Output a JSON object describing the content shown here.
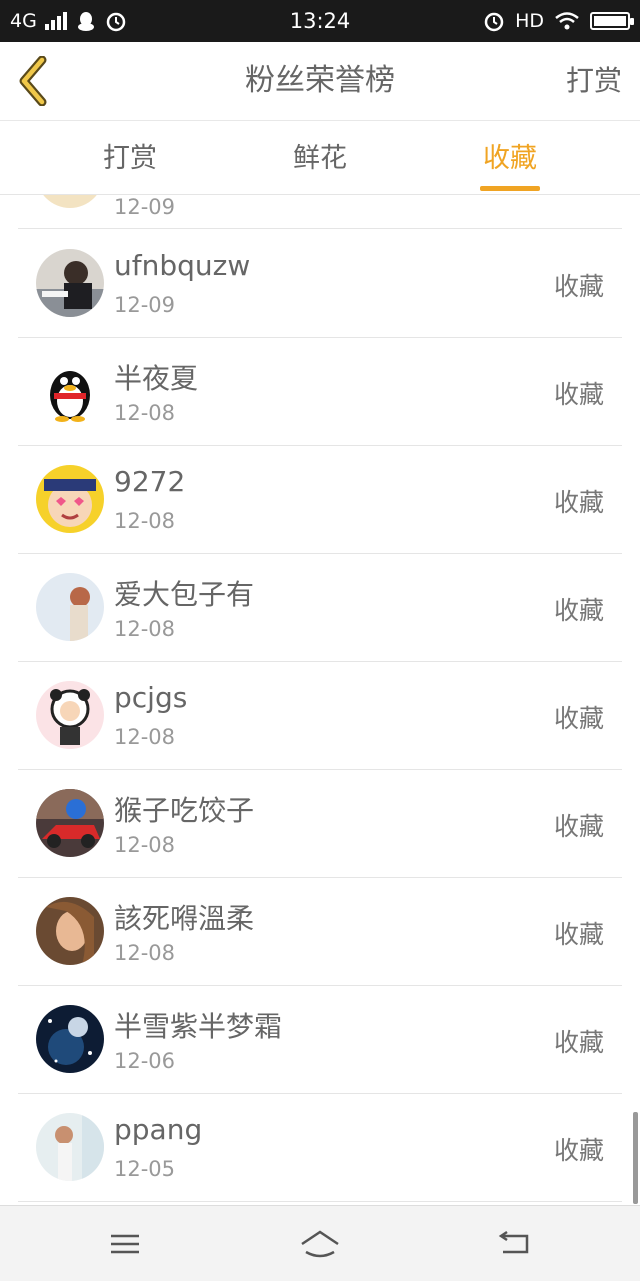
{
  "status_bar": {
    "network": "4G",
    "time": "13:24",
    "hd_label": "HD",
    "battery_level": 1.0,
    "icons": [
      "signal-icon",
      "qq-icon",
      "alarm-icon",
      "alarm-icon",
      "wifi-icon",
      "battery-icon"
    ]
  },
  "header": {
    "title": "粉丝荣誉榜",
    "back_icon": "chevron-left-icon",
    "action_label": "打赏"
  },
  "tabs": [
    {
      "label": "打赏",
      "active": false
    },
    {
      "label": "鲜花",
      "active": false
    },
    {
      "label": "收藏",
      "active": true
    }
  ],
  "colors": {
    "accent": "#f0a423",
    "text_primary": "#666666",
    "text_secondary": "#999999",
    "status_bar_bg": "#1a1a1a"
  },
  "list": {
    "partial_top_date": "12-09",
    "items": [
      {
        "name": "ufnbquzw",
        "date": "12-09",
        "action": "收藏"
      },
      {
        "name": "半夜夏",
        "date": "12-08",
        "action": "收藏"
      },
      {
        "name": "9272",
        "date": "12-08",
        "action": "收藏"
      },
      {
        "name": "爱大包子有",
        "date": "12-08",
        "action": "收藏"
      },
      {
        "name": "pcjgs",
        "date": "12-08",
        "action": "收藏"
      },
      {
        "name": "猴子吃饺子",
        "date": "12-08",
        "action": "收藏"
      },
      {
        "name": "該死嘚溫柔",
        "date": "12-08",
        "action": "收藏"
      },
      {
        "name": "半雪紫半梦霜",
        "date": "12-06",
        "action": "收藏"
      },
      {
        "name": "ppang",
        "date": "12-05",
        "action": "收藏"
      }
    ]
  },
  "nav_bar": {
    "icons": [
      "menu-icon",
      "home-icon",
      "back-icon"
    ]
  }
}
